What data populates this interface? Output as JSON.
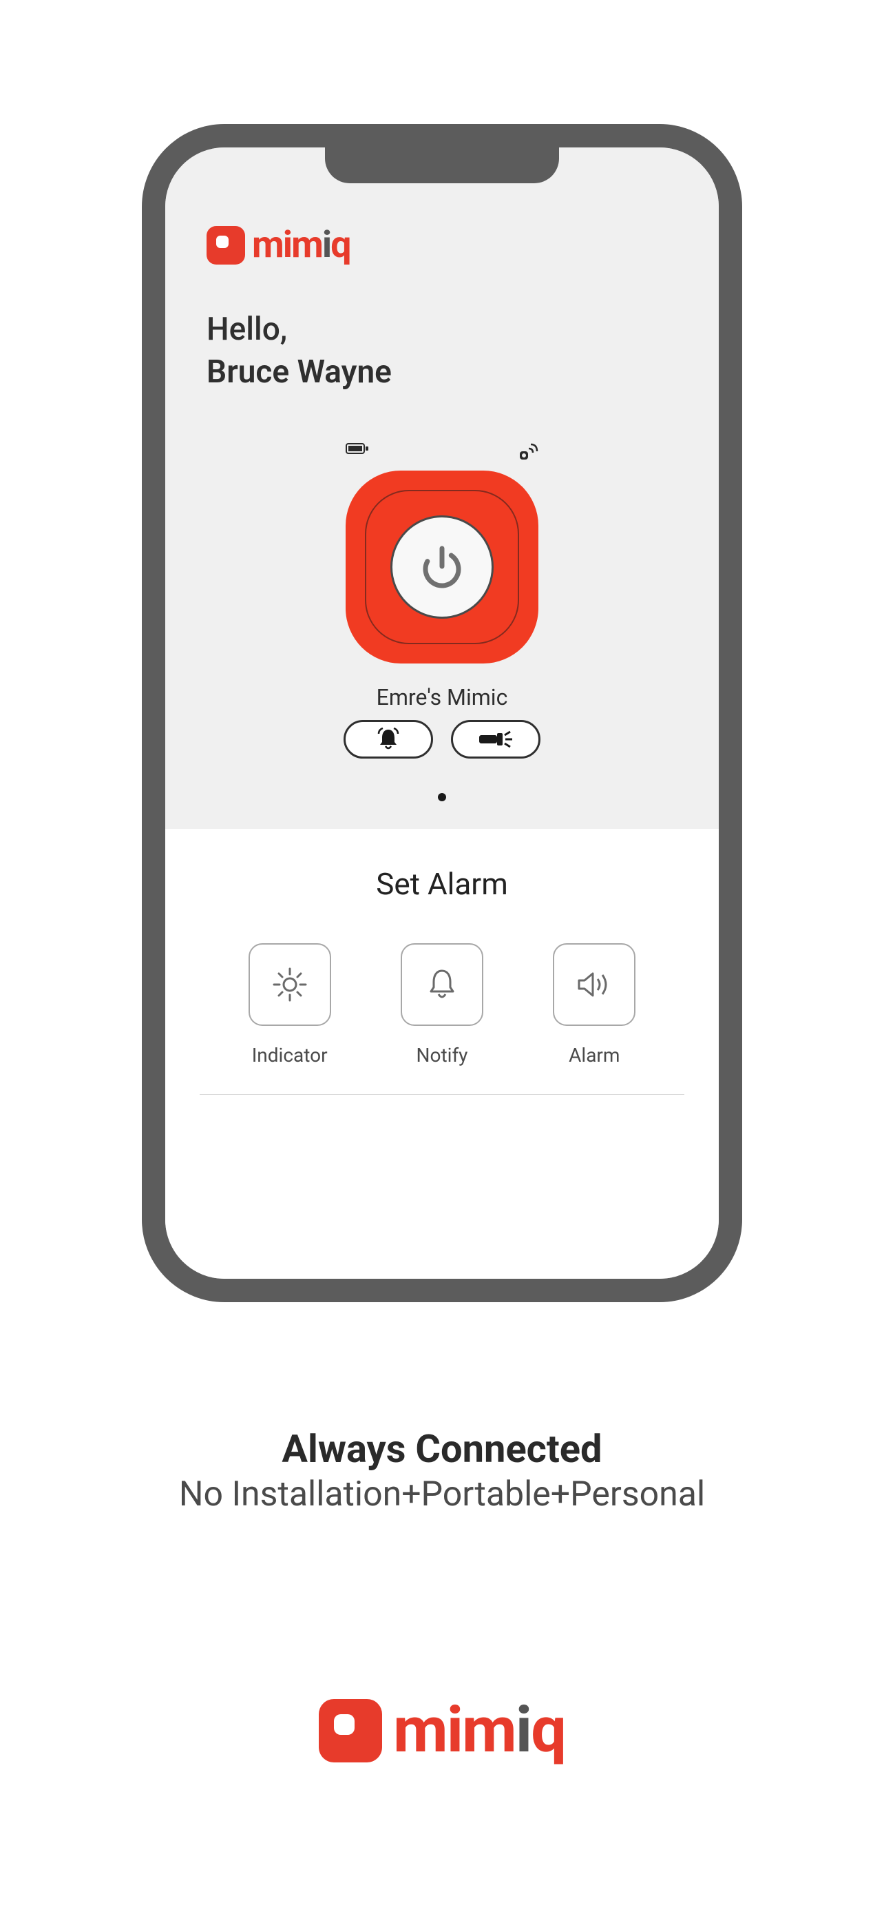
{
  "brand": {
    "name": "mimiq"
  },
  "greeting": {
    "hello": "Hello,",
    "name": "Bruce Wayne"
  },
  "device": {
    "name": "Emre's Mimic"
  },
  "alarm": {
    "title": "Set Alarm",
    "options": {
      "indicator": "Indicator",
      "notify": "Notify",
      "alarm": "Alarm"
    }
  },
  "marketing": {
    "headline": "Always Connected",
    "subline": "No Installation+Portable+Personal"
  },
  "icons": {
    "battery": "battery-icon",
    "signal": "signal-icon",
    "power": "power-icon",
    "bell": "bell-icon",
    "flashlight": "flashlight-icon",
    "sun": "sun-icon",
    "notifyBell": "bell-icon",
    "speaker": "speaker-icon"
  },
  "colors": {
    "accent": "#e73b2b",
    "buttonRed": "#f13b22",
    "text": "#2f2f2f"
  }
}
